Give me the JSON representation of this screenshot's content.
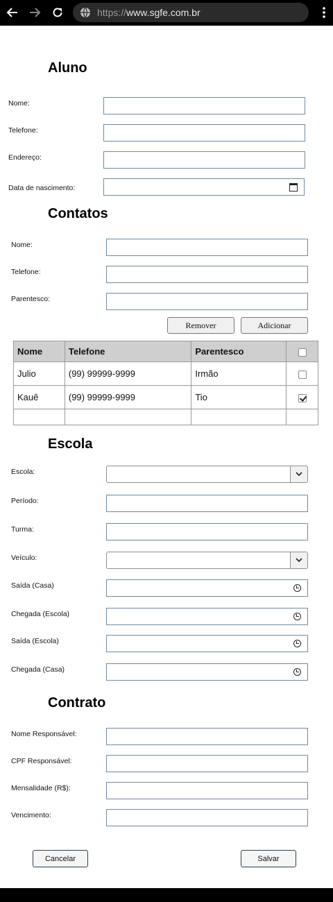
{
  "browser": {
    "url_scheme": "https://",
    "url_host": "www.sgfe.com.br"
  },
  "aluno": {
    "title": "Aluno",
    "nome_label": "Nome:",
    "telefone_label": "Telefone:",
    "endereco_label": "Endereço:",
    "nascimento_label": "Data de nascimento:"
  },
  "contatos": {
    "title": "Contatos",
    "nome_label": "Nome:",
    "telefone_label": "Telefone:",
    "parentesco_label": "Parentesco:",
    "remover_label": "Remover",
    "adicionar_label": "Adicionar",
    "table": {
      "headers": [
        "Nome",
        "Telefone",
        "Parentesco"
      ],
      "rows": [
        {
          "nome": "Julio",
          "telefone": "(99) 99999-9999",
          "parentesco": "Irmão",
          "checked": false
        },
        {
          "nome": "Kauê",
          "telefone": "(99) 99999-9999",
          "parentesco": "Tio",
          "checked": true
        }
      ]
    }
  },
  "escola": {
    "title": "Escola",
    "escola_label": "Escola:",
    "periodo_label": "Período:",
    "turma_label": "Turma:",
    "veiculo_label": "Veículo:",
    "saida_casa_label": "Saída (Casa)",
    "chegada_escola_label": "Chegada (Escola)",
    "saida_escola_label": "Saída (Escola)",
    "chegada_casa_label": "Chegada (Casa)"
  },
  "contrato": {
    "title": "Contrato",
    "nome_resp_label": "Nome Responsável:",
    "cpf_resp_label": "CPF Responsável:",
    "mensalidade_label": "Mensalidade (R$):",
    "vencimento_label": "Vencimento:"
  },
  "actions": {
    "cancelar_label": "Cancelar",
    "salvar_label": "Salvar"
  }
}
